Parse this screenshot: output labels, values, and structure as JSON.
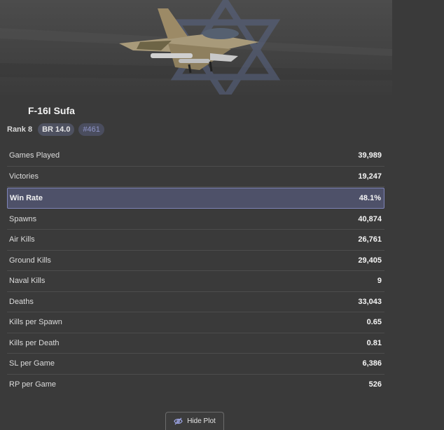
{
  "vehicle": {
    "name": "F-16I Sufa",
    "rank": "Rank 8",
    "br": "BR 14.0",
    "position": "#461"
  },
  "stats": [
    {
      "label": "Games Played",
      "value": "39,989"
    },
    {
      "label": "Victories",
      "value": "19,247"
    },
    {
      "label": "Win Rate",
      "value": "48.1%"
    },
    {
      "label": "Spawns",
      "value": "40,874"
    },
    {
      "label": "Air Kills",
      "value": "26,761"
    },
    {
      "label": "Ground Kills",
      "value": "29,405"
    },
    {
      "label": "Naval Kills",
      "value": "9"
    },
    {
      "label": "Deaths",
      "value": "33,043"
    },
    {
      "label": "Kills per Spawn",
      "value": "0.65"
    },
    {
      "label": "Kills per Death",
      "value": "0.81"
    },
    {
      "label": "SL per Game",
      "value": "6,386"
    },
    {
      "label": "RP per Game",
      "value": "526"
    }
  ],
  "plot_button": {
    "label": "Hide Plot",
    "icon": "eye-slash-icon"
  },
  "colors": {
    "background": "#3a3a3a",
    "highlight_row": "#4e5169",
    "highlight_border": "#7e84b8",
    "position_badge_text": "#8f95c8"
  }
}
